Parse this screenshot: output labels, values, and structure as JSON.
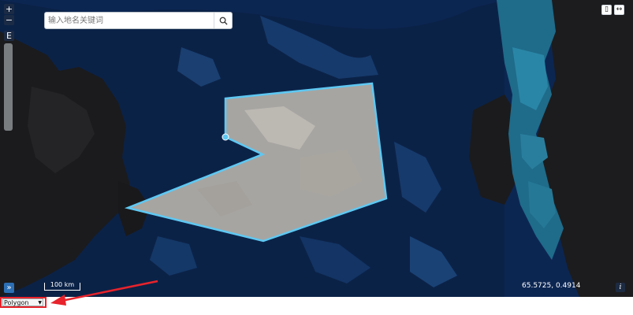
{
  "search": {
    "placeholder": "输入地名关键词"
  },
  "controls": {
    "zoom_in_label": "+",
    "zoom_out_label": "−",
    "layer_label": "E",
    "expand_label": "»",
    "info_label": "i",
    "top_right_1_label": "▯",
    "top_right_2_label": "↔",
    "zoom_level": 0.72
  },
  "scale": {
    "label": "100 km"
  },
  "coordinates": {
    "text": "65.5725,  0.4914"
  },
  "draw_mode": {
    "selected": "Polygon"
  },
  "colors": {
    "water": "#0b2450",
    "land": "#1c1c1e",
    "polygon_fill": "#b5b1aa",
    "polygon_stroke": "#5ec8f2",
    "annotation": "#e8232b",
    "shallow": "#1e6f8e"
  },
  "icons": [
    "search-icon",
    "zoom-in-icon",
    "zoom-out-icon",
    "layer-icon",
    "expand-icon",
    "info-icon",
    "vertex-icon",
    "annotation-arrow"
  ]
}
